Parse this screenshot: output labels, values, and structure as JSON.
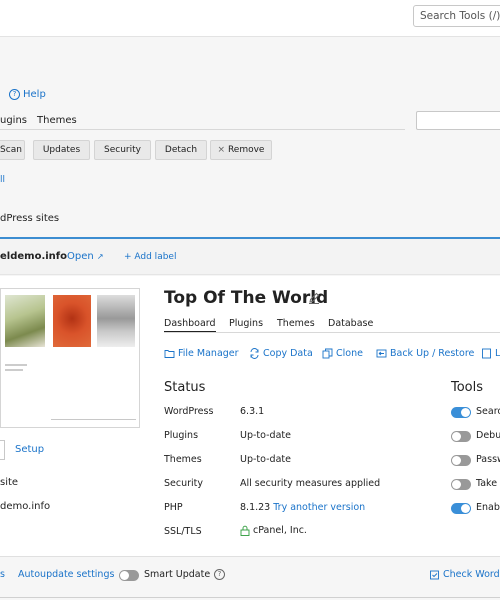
{
  "search": {
    "value": "Search Tools (/)"
  },
  "help": {
    "label": "Help"
  },
  "filter_tabs": [
    "ugins",
    "Themes"
  ],
  "actions_row": {
    "scan": "Scan",
    "updates": "Updates",
    "security": "Security",
    "detach": "Detach",
    "remove": "Remove"
  },
  "select_all": "ll",
  "wp_sites_label": "dPress sites",
  "site": {
    "domain": "eldemo.info",
    "open_label": "Open",
    "add_label": "+ Add label",
    "title": "Top Of The World",
    "tabs": [
      "Dashboard",
      "Plugins",
      "Themes",
      "Database"
    ],
    "actions": [
      "File Manager",
      "Copy Data",
      "Clone",
      "Back Up / Restore",
      "Lo"
    ],
    "status_heading": "Status",
    "status": [
      {
        "key": "WordPress",
        "value": "6.3.1",
        "extra": ""
      },
      {
        "key": "Plugins",
        "value": "Up-to-date",
        "extra": ""
      },
      {
        "key": "Themes",
        "value": "Up-to-date",
        "extra": ""
      },
      {
        "key": "Security",
        "value": "",
        "extra": "All security measures applied"
      },
      {
        "key": "PHP",
        "value": "8.1.23",
        "extra": "Try another version"
      },
      {
        "key": "SSL/TLS",
        "value": "cPanel, Inc.",
        "extra": ""
      }
    ],
    "tools_heading": "Tools",
    "tools": [
      {
        "label": "Searc",
        "on": true
      },
      {
        "label": "Debu",
        "on": false
      },
      {
        "label": "Passw",
        "on": false
      },
      {
        "label": "Take o",
        "on": false
      },
      {
        "label": "Enabl",
        "on": true
      }
    ],
    "setup_label": "Setup",
    "site_label": "site",
    "site_url": "demo.info"
  },
  "footer": {
    "left_cut": "s",
    "autoupdate": "Autoupdate settings",
    "smart_update": "Smart Update",
    "check": "Check WordP"
  },
  "colors": {
    "accent": "#1a73c9",
    "toggle_on": "#3a8fd8",
    "toggle_off": "#999999"
  }
}
